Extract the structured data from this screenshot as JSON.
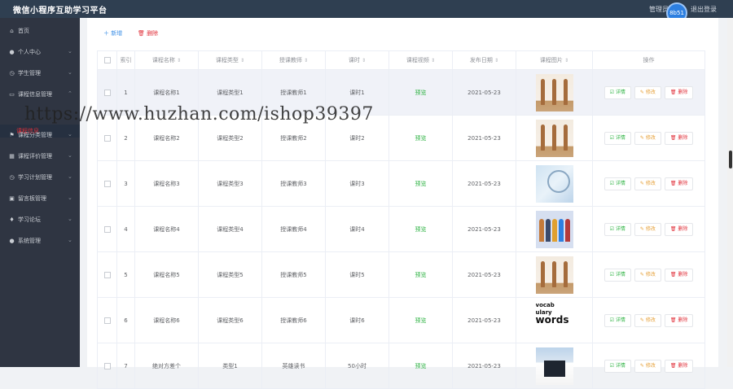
{
  "header": {
    "title": "微信小程序互助学习平台",
    "admin_label": "管理员",
    "avatar_text": "8b51",
    "logout_label": "退出登录"
  },
  "sidebar": {
    "items": [
      {
        "label": "首页",
        "icon": "home-icon",
        "has_chevron": false
      },
      {
        "label": "个人中心",
        "icon": "user-icon",
        "has_chevron": true
      },
      {
        "label": "学生管理",
        "icon": "clock-icon",
        "has_chevron": true
      },
      {
        "label": "课程信息管理",
        "icon": "monitor-icon",
        "has_chevron": true,
        "expanded": true
      },
      {
        "label": "课程分类管理",
        "icon": "flag-icon",
        "has_chevron": true
      },
      {
        "label": "课程评价管理",
        "icon": "grid-icon",
        "has_chevron": true
      },
      {
        "label": "学习计划管理",
        "icon": "clock-icon",
        "has_chevron": true
      },
      {
        "label": "留言板管理",
        "icon": "image-icon",
        "has_chevron": true
      },
      {
        "label": "学习论坛",
        "icon": "pin-icon",
        "has_chevron": true
      },
      {
        "label": "系统管理",
        "icon": "user-icon",
        "has_chevron": true
      }
    ],
    "sub_item_label": "课程信息"
  },
  "toolbar": {
    "add_label": "新增",
    "delete_label": "删除"
  },
  "table": {
    "headers": [
      "索引",
      "课程名称",
      "课程类型",
      "授课教师",
      "课时",
      "课程视频",
      "发布日期",
      "课程图片",
      "操作"
    ],
    "rows": [
      {
        "index": "1",
        "name": "课程名称1",
        "type": "课程类型1",
        "teacher": "授课教师1",
        "hours": "课时1",
        "video": "预览",
        "date": "2021-05-23",
        "image": "dance"
      },
      {
        "index": "2",
        "name": "课程名称2",
        "type": "课程类型2",
        "teacher": "授课教师2",
        "hours": "课时2",
        "video": "预览",
        "date": "2021-05-23",
        "image": "dance"
      },
      {
        "index": "3",
        "name": "课程名称3",
        "type": "课程类型3",
        "teacher": "授课教师3",
        "hours": "课时3",
        "video": "预览",
        "date": "2021-05-23",
        "image": "sketch"
      },
      {
        "index": "4",
        "name": "课程名称4",
        "type": "课程类型4",
        "teacher": "授课教师4",
        "hours": "课时4",
        "video": "预览",
        "date": "2021-05-23",
        "image": "people"
      },
      {
        "index": "5",
        "name": "课程名称5",
        "type": "课程类型5",
        "teacher": "授课教师5",
        "hours": "课时5",
        "video": "预览",
        "date": "2021-05-23",
        "image": "dance"
      },
      {
        "index": "6",
        "name": "课程名称6",
        "type": "课程类型6",
        "teacher": "授课教师6",
        "hours": "课时6",
        "video": "预览",
        "date": "2021-05-23",
        "image": "words"
      },
      {
        "index": "7",
        "name": "绝对方差个",
        "type": "类型1",
        "teacher": "英雄读书",
        "hours": "50小时",
        "video": "预览",
        "date": "2021-05-23",
        "image": "house"
      }
    ],
    "actions": {
      "detail": "详情",
      "edit": "修改",
      "remove": "删除"
    }
  },
  "watermark": "https://www.huzhan.com/ishop39397",
  "colors": {
    "topbar": "#2f3f51",
    "sidebar": "#2f3542",
    "primary": "#3a8ee6",
    "danger": "#e0303a",
    "success": "#2fb344",
    "warning": "#e6a23c"
  }
}
